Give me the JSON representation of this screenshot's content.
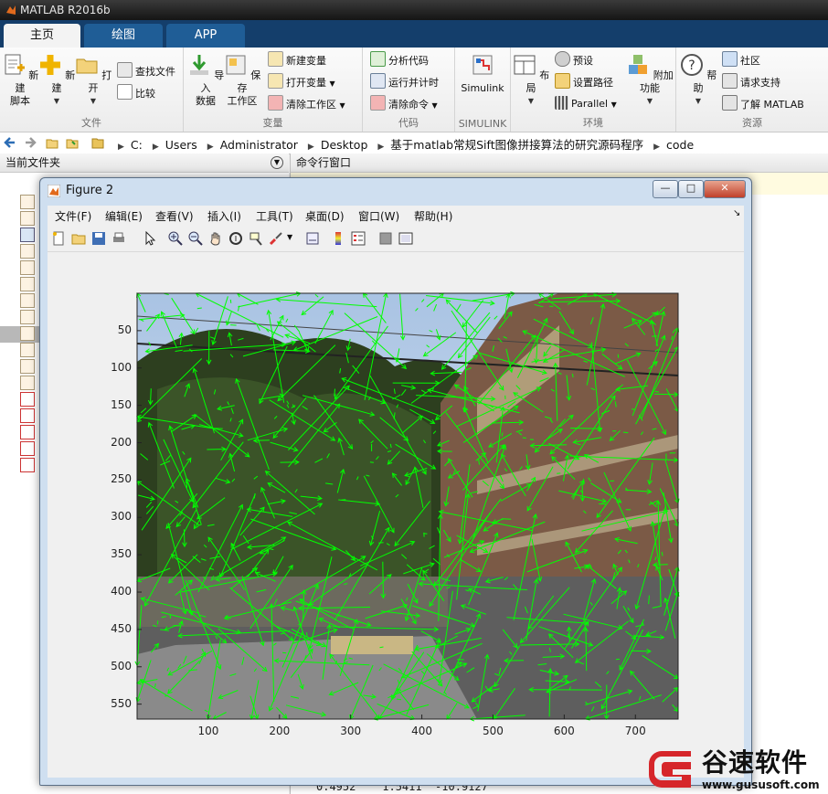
{
  "app": {
    "title": "MATLAB R2016b"
  },
  "tabs": [
    {
      "label": "主页",
      "active": true
    },
    {
      "label": "绘图",
      "active": false
    },
    {
      "label": "APP",
      "active": false
    }
  ],
  "ribbon": {
    "file": {
      "label": "文件",
      "new_script": "新建\n脚本",
      "new": "新建",
      "open": "打开",
      "find_files": "查找文件",
      "compare": "比较"
    },
    "variable": {
      "label": "变量",
      "import_data": "导入\n数据",
      "save_workspace": "保存\n工作区",
      "new_variable": "新建变量",
      "open_variable": "打开变量",
      "clear_workspace": "清除工作区"
    },
    "code": {
      "label": "代码",
      "analyze_code": "分析代码",
      "run_and_time": "运行并计时",
      "clear_commands": "清除命令"
    },
    "simulink": {
      "label": "SIMULINK",
      "simulink": "Simulink"
    },
    "environment": {
      "label": "环境",
      "layout": "布局",
      "preferences": "预设",
      "set_path": "设置路径",
      "parallel": "Parallel",
      "add_ons": "附加功能"
    },
    "resources": {
      "label": "资源",
      "help": "帮助",
      "community": "社区",
      "request_support": "请求支持",
      "learn_matlab": "了解 MATLAB"
    }
  },
  "address_bar": {
    "crumbs": [
      "C:",
      "Users",
      "Administrator",
      "Desktop",
      "基于matlab常规Sift图像拼接算法的研究源码程序",
      "code"
    ]
  },
  "panels": {
    "current_folder": "当前文件夹",
    "command_window": "命令行窗口",
    "command_output": "0.4952    1.5411  -10.9127"
  },
  "file_list": [
    "m",
    "m",
    "fig",
    "m",
    "m",
    "m",
    "m",
    "mlx",
    "m",
    "m",
    "m",
    "m",
    "png",
    "png",
    "png",
    "png",
    "png"
  ],
  "figure": {
    "title": "Figure 2",
    "menu": [
      "文件(F)",
      "编辑(E)",
      "查看(V)",
      "插入(I)",
      "工具(T)",
      "桌面(D)",
      "窗口(W)",
      "帮助(H)"
    ]
  },
  "plot": {
    "yticks": [
      "50",
      "100",
      "150",
      "200",
      "250",
      "300",
      "350",
      "400",
      "450",
      "500",
      "550"
    ],
    "xticks": [
      "100",
      "200",
      "300",
      "400",
      "500",
      "600",
      "700"
    ],
    "x_range": [
      0,
      760
    ],
    "y_range": [
      0,
      570
    ],
    "feature_color": "#00ff00"
  },
  "watermark": {
    "name": "谷速软件",
    "url": "www.gususoft.com",
    "color": "#d6262a"
  }
}
